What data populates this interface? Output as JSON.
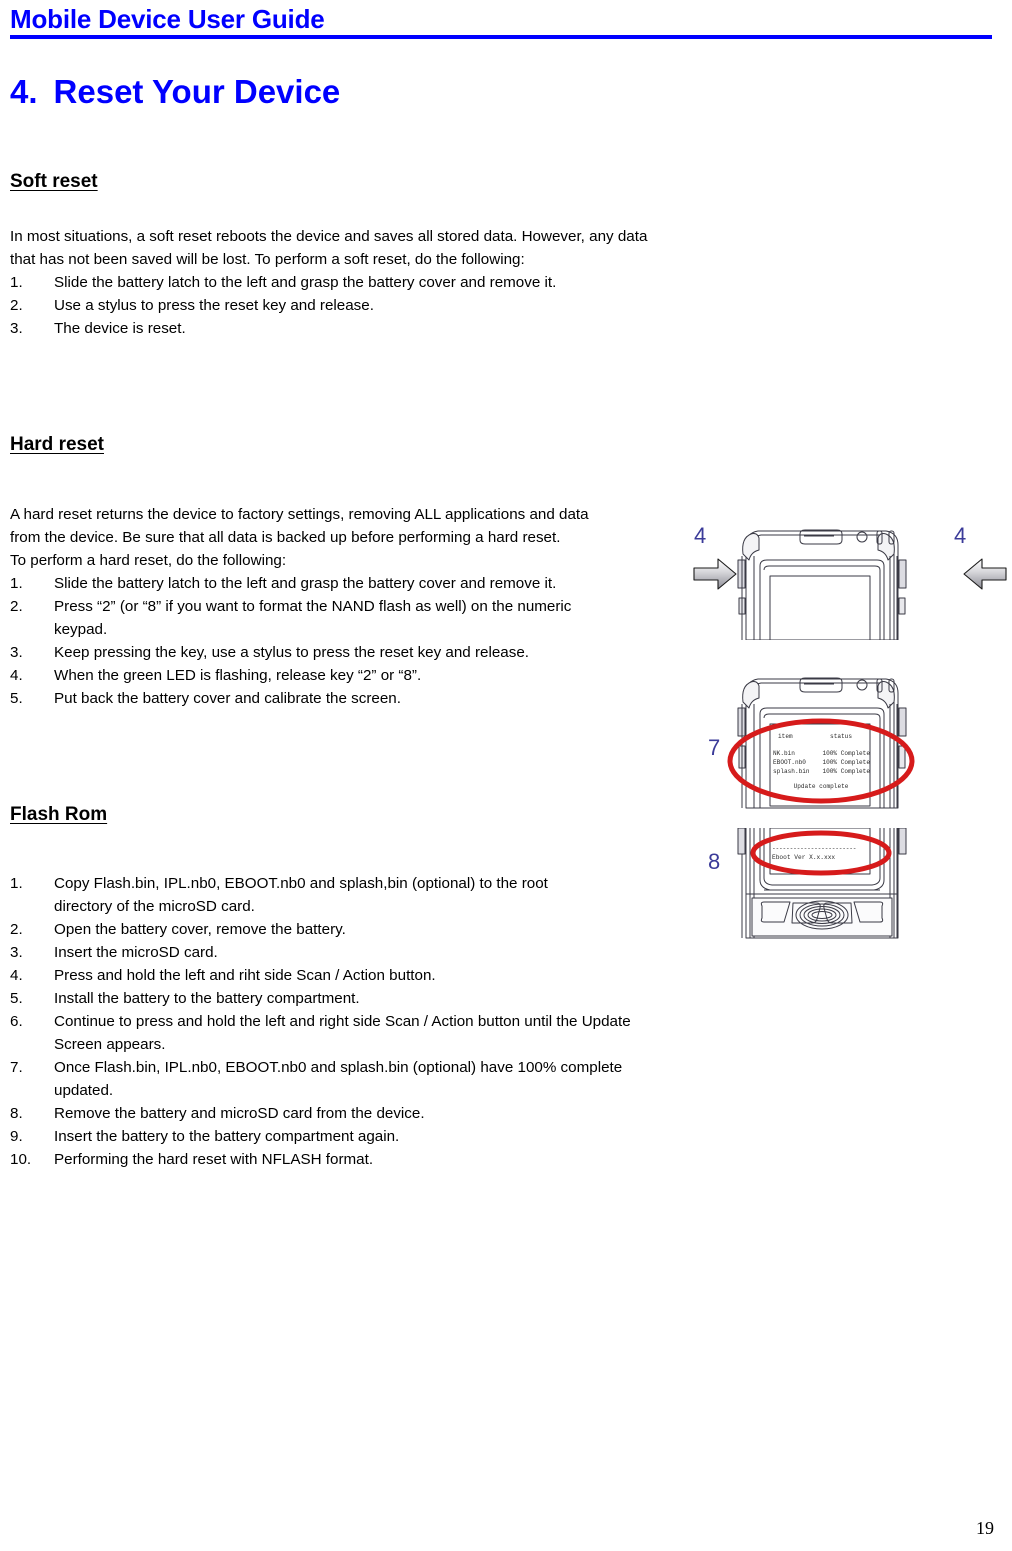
{
  "header": {
    "title": "Mobile Device User Guide",
    "rule_color": "#0000ff"
  },
  "chapter": {
    "number": "4.",
    "title": "Reset Your Device",
    "color": "#0000ff"
  },
  "sections": [
    {
      "heading": "Soft reset",
      "paragraph_lines": [
        "In most situations, a soft reset reboots the device and saves all stored data. However, any data",
        "that has not been saved will be lost. To perform a soft reset, do the following:"
      ],
      "steps": [
        {
          "mark": "1.",
          "line1": "Slide the battery latch to the left and grasp the battery cover and remove it.",
          "line2": ""
        },
        {
          "mark": "2.",
          "line1": "Use a stylus to press the reset key and release.",
          "line2": ""
        },
        {
          "mark": "3.",
          "line1": "The device is reset.",
          "line2": ""
        }
      ]
    },
    {
      "heading": "Hard reset",
      "paragraph_lines": [
        "A hard reset returns the device to factory settings, removing ALL applications and data",
        "from the device. Be sure that all data is backed up before performing a hard reset.",
        "To perform a hard reset, do the following:"
      ],
      "steps": [
        {
          "mark": "1.",
          "line1": "Slide the battery latch to the left and grasp the battery cover and remove it.",
          "line2": ""
        },
        {
          "mark": "2.",
          "line1": "Press “2” (or “8” if you want to format the NAND flash as well) on the numeric",
          "line2": "keypad."
        },
        {
          "mark": "3.",
          "line1": "Keep pressing the key, use a stylus to press the reset key and release.",
          "line2": ""
        },
        {
          "mark": "4.",
          "line1": "When the green LED is flashing, release key “2” or “8”.",
          "line2": ""
        },
        {
          "mark": "5.",
          "line1": "Put back the battery cover and calibrate the screen.",
          "line2": ""
        }
      ]
    },
    {
      "heading": "Flash Rom",
      "paragraph_lines": [],
      "steps": [
        {
          "mark": "1.",
          "line1": "Copy Flash.bin, IPL.nb0, EBOOT.nb0 and splash,bin (optional) to the root",
          "line2": "directory of the microSD card."
        },
        {
          "mark": "2.",
          "line1": "Open the battery cover, remove the battery.",
          "line2": ""
        },
        {
          "mark": "3.",
          "line1": "Insert the microSD card.",
          "line2": ""
        },
        {
          "mark": "4.",
          "line1": "Press and hold the left and riht side Scan / Action button.",
          "line2": ""
        },
        {
          "mark": "5.",
          "line1": "Install the battery to the battery compartment.",
          "line2": ""
        },
        {
          "mark": "6.",
          "line1": "Continue to press and hold the left and right side Scan / Action button until the Update",
          "line2": "Screen appears."
        },
        {
          "mark": "7.",
          "line1": "Once Flash.bin, IPL.nb0, EBOOT.nb0 and splash.bin (optional) have 100% complete",
          "line2": "updated."
        },
        {
          "mark": "8.",
          "line1": "Remove the battery and microSD card from the device.",
          "line2": ""
        },
        {
          "mark": "9.",
          "line1": "Insert the battery to the battery compartment again.",
          "line2": ""
        },
        {
          "mark": "10.",
          "line1": "Performing the hard reset with NFLASH format.",
          "line2": ""
        }
      ]
    }
  ],
  "figures": [
    {
      "id": "device-top-arrows",
      "label_left": "4",
      "label_right": "4",
      "label_color": "#3b3b99",
      "screen_text": []
    },
    {
      "id": "device-update-screen",
      "label_left": "7",
      "label_color": "#3b3b99",
      "highlight_color": "#d61b1b",
      "screen_text": {
        "col_header_item": "item",
        "col_header_status": "status",
        "rows": [
          {
            "item": "NK.bin",
            "status": "100% Complete"
          },
          {
            "item": "EBOOT.nb0",
            "status": "100% Complete"
          },
          {
            "item": "splash.bin",
            "status": "100% Complete"
          }
        ],
        "footer": "Update complete"
      }
    },
    {
      "id": "device-eboot-version",
      "label_left": "8",
      "label_color": "#3b3b99",
      "highlight_color": "#d61b1b",
      "screen_text": {
        "divider": "------------------------",
        "line": "Eboot Ver  X.x.xxx"
      }
    }
  ],
  "footer": {
    "page_number": "19"
  }
}
